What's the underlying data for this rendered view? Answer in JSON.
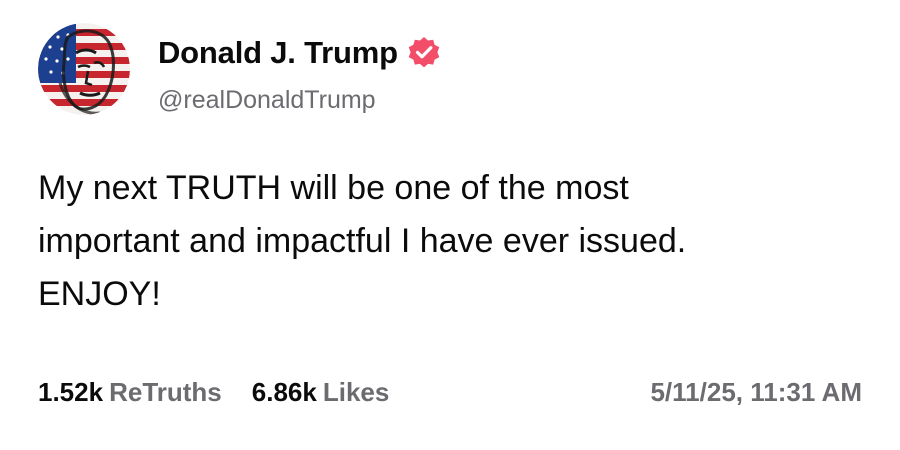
{
  "author": {
    "display_name": "Donald J. Trump",
    "handle": "@realDonaldTrump",
    "avatar_icon": "flag-portrait-avatar",
    "verified_icon": "verified-badge-icon"
  },
  "post": {
    "lines": [
      "My next TRUTH will be one of the most",
      "important and impactful I have ever issued.",
      "ENJOY!"
    ]
  },
  "stats": {
    "retruths_count": "1.52k",
    "retruths_label": "ReTruths",
    "likes_count": "6.86k",
    "likes_label": "Likes"
  },
  "timestamp": "5/11/25, 11:31 AM",
  "colors": {
    "verified": "#f24e6a",
    "muted_text": "#6b6b70",
    "text": "#0b0b0b"
  }
}
